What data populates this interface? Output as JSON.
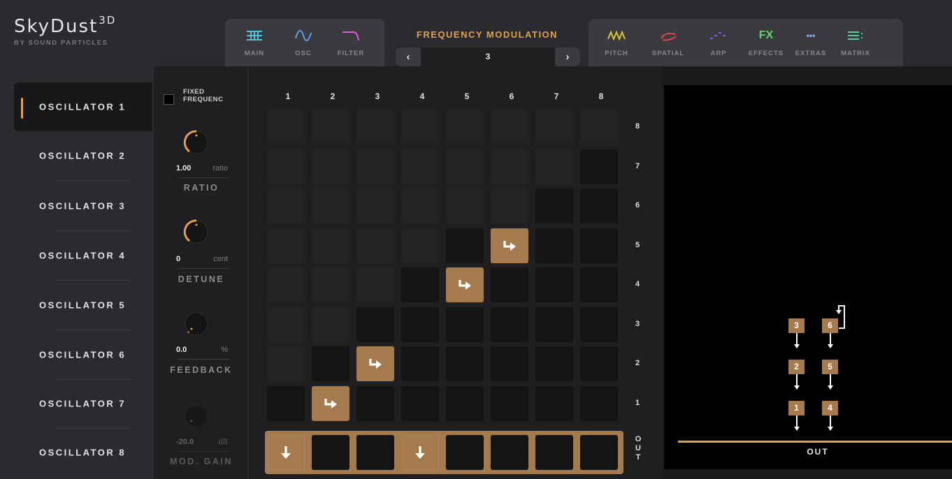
{
  "brand": {
    "title": "SkyDust",
    "superscript": "3D",
    "subtitle": "BY SOUND PARTICLES"
  },
  "nav": {
    "left": [
      {
        "label": "MAIN",
        "icon": "grid-icon",
        "color": "#4fc4d8"
      },
      {
        "label": "OSC",
        "icon": "sine-wave-icon",
        "color": "#5da2ee"
      },
      {
        "label": "FILTER",
        "icon": "filter-curve-icon",
        "color": "#e05bd7"
      }
    ],
    "right": [
      {
        "label": "PITCH",
        "icon": "pitch-wave-icon",
        "color": "#d7c43a"
      },
      {
        "label": "SPATIAL",
        "icon": "spatial-swirl-icon",
        "color": "#e04848"
      },
      {
        "label": "ARP",
        "icon": "arp-steps-icon",
        "color": "#8a5bf0"
      },
      {
        "label": "EFFECTS",
        "icon": "fx-icon",
        "icon_text": "FX",
        "color": "#5fd46a"
      },
      {
        "label": "EXTRAS",
        "icon": "dots-icon",
        "icon_text": "•••",
        "color": "#8ab4ff"
      },
      {
        "label": "MATRIX",
        "icon": "matrix-lines-icon",
        "color": "#4fd2a0"
      }
    ]
  },
  "fm": {
    "title": "FREQUENCY MODULATION",
    "value": "3",
    "prev": "‹",
    "next": "›"
  },
  "oscillators": [
    {
      "label": "OSCILLATOR 1",
      "active": true
    },
    {
      "label": "OSCILLATOR 2"
    },
    {
      "label": "OSCILLATOR 3"
    },
    {
      "label": "OSCILLATOR 4"
    },
    {
      "label": "OSCILLATOR 5"
    },
    {
      "label": "OSCILLATOR 6"
    },
    {
      "label": "OSCILLATOR 7"
    },
    {
      "label": "OSCILLATOR 8"
    }
  ],
  "controls": {
    "fixed_label_1": "FIXED",
    "fixed_label_2": "FREQUENC",
    "fixed_checked": false,
    "ratio": {
      "value": "1.00",
      "unit": "ratio",
      "title": "RATIO"
    },
    "detune": {
      "value": "0",
      "unit": "cent",
      "title": "DETUNE"
    },
    "feedback": {
      "value": "0.0",
      "unit": "%",
      "title": "FEEDBACK"
    },
    "mod_gain": {
      "value": "-20.0",
      "unit": "dB",
      "title": "MOD. GAIN"
    }
  },
  "matrix": {
    "columns": [
      "1",
      "2",
      "3",
      "4",
      "5",
      "6",
      "7",
      "8"
    ],
    "rows": [
      "8",
      "7",
      "6",
      "5",
      "4",
      "3",
      "2",
      "1"
    ],
    "out_label": "OUT",
    "routes": [
      {
        "from": 2,
        "to": 1
      },
      {
        "from": 3,
        "to": 2
      },
      {
        "from": 5,
        "to": 4
      },
      {
        "from": 6,
        "to": 5
      }
    ],
    "out_active": [
      1,
      4
    ]
  },
  "preview": {
    "boxes": [
      "1",
      "2",
      "3",
      "4",
      "5",
      "6"
    ],
    "out_label": "OUT"
  },
  "colors": {
    "accent": "#e3a04a",
    "active_cell": "#a57b4d"
  }
}
